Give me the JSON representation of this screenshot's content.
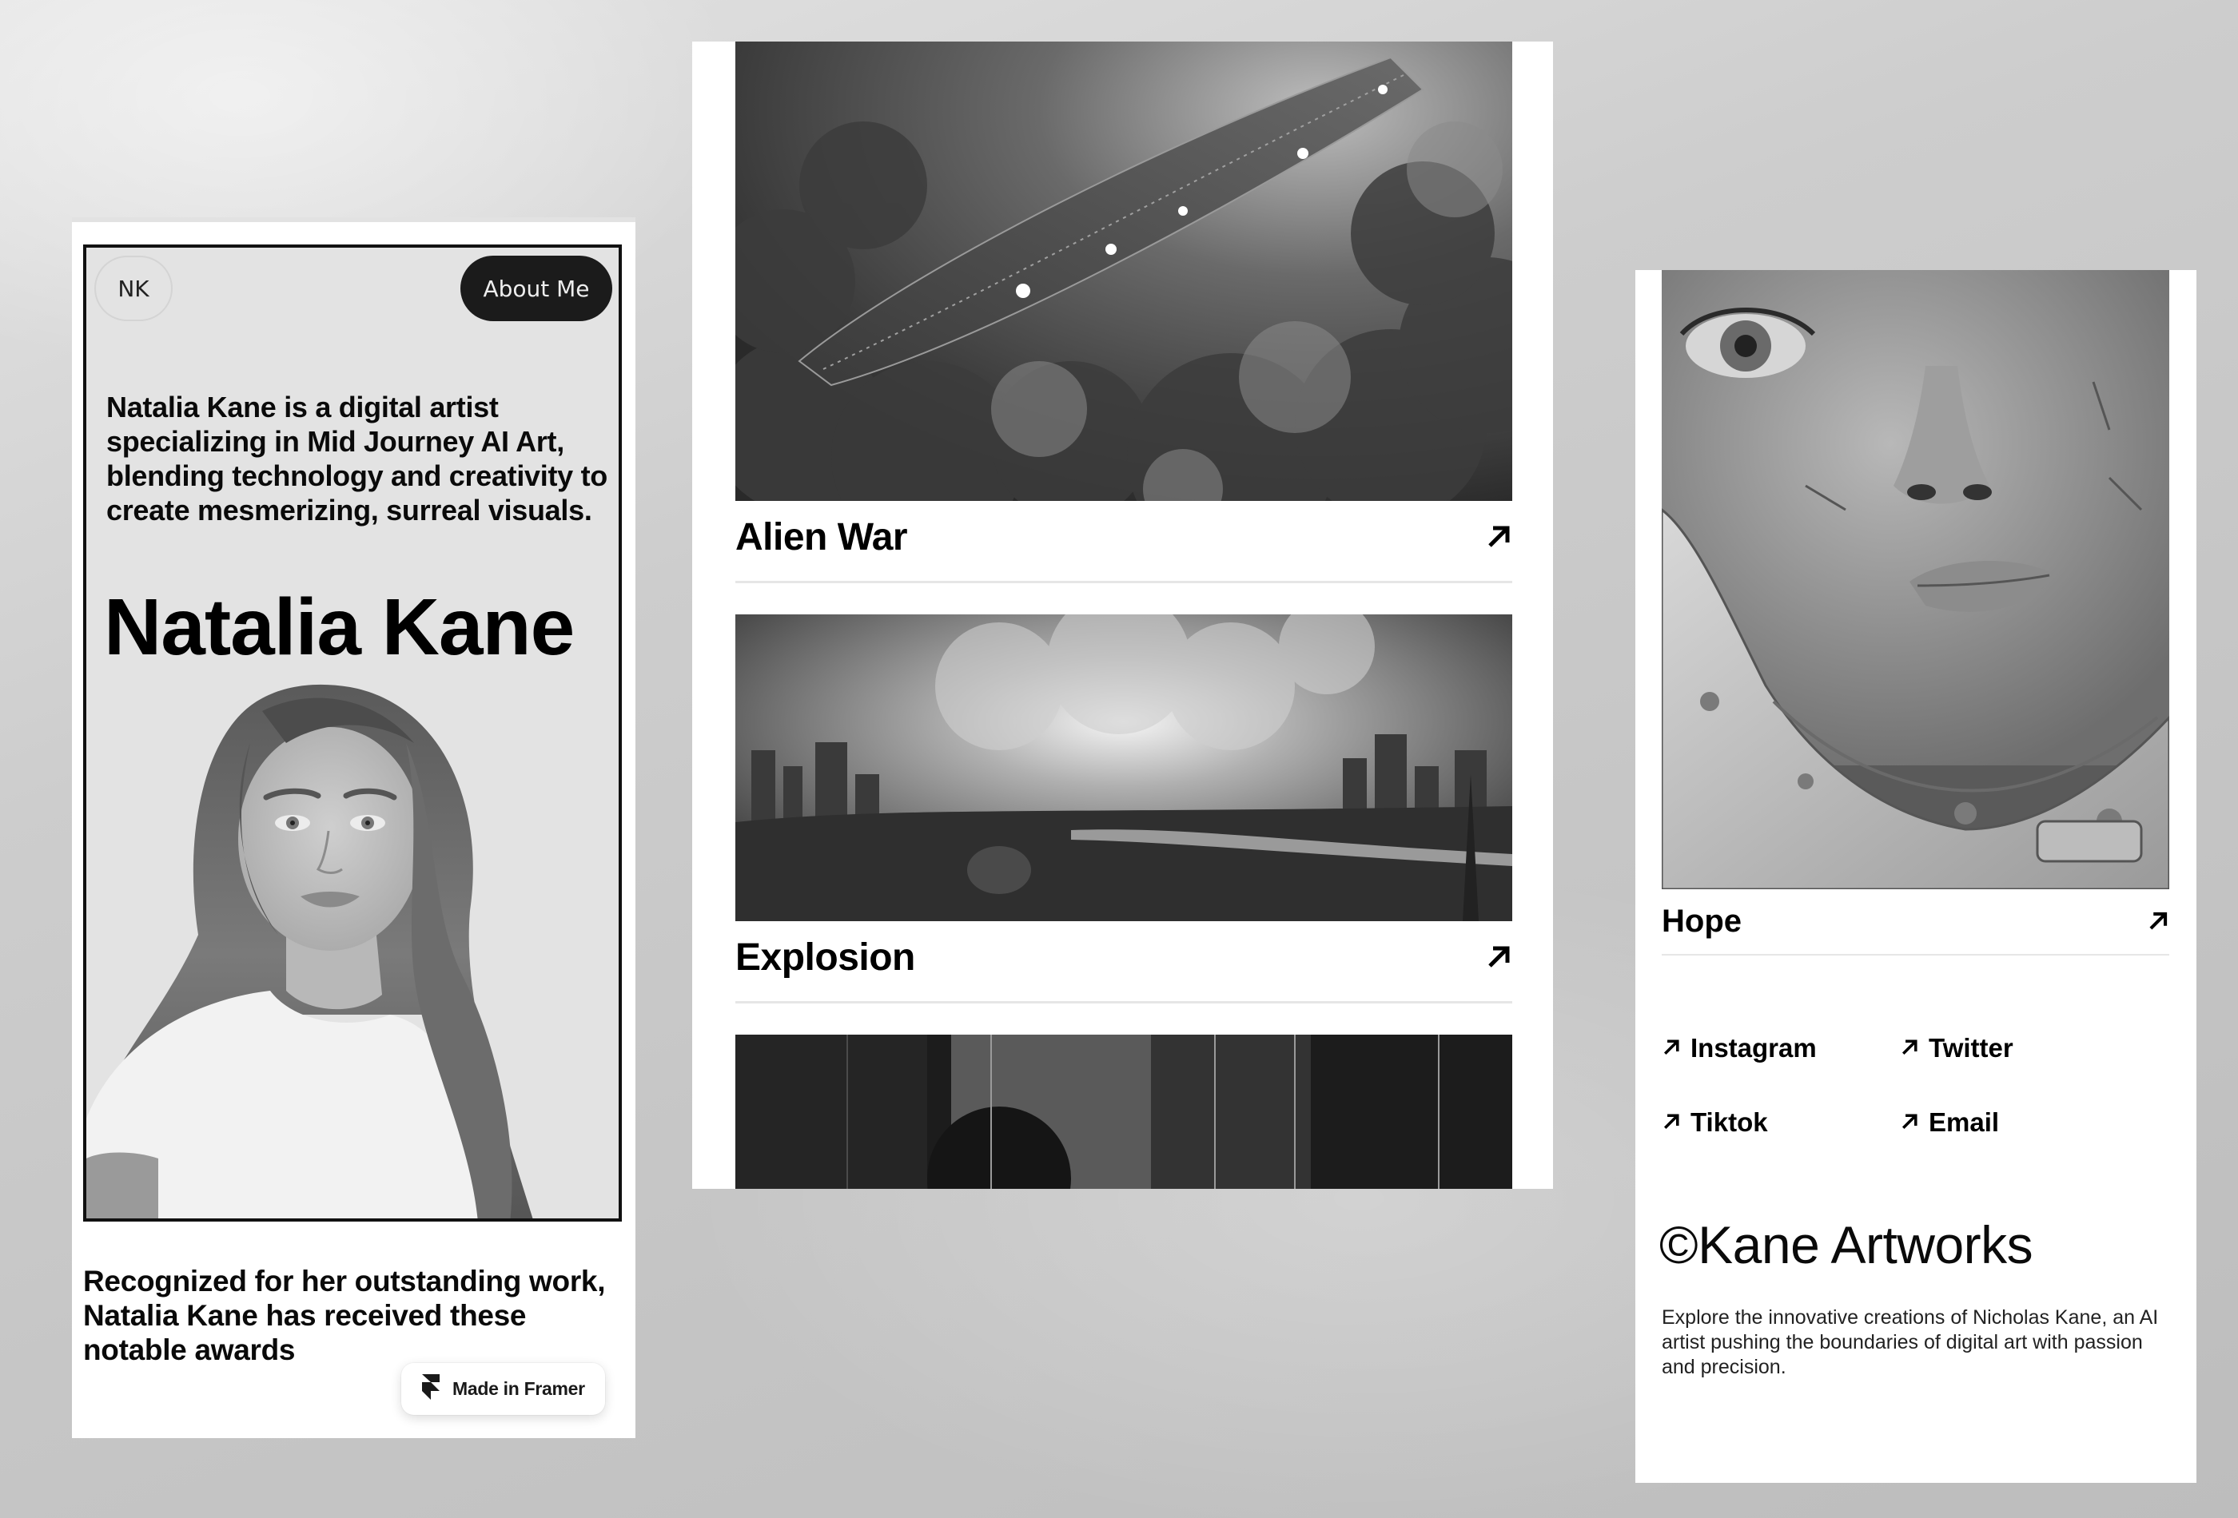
{
  "left_panel": {
    "nav": {
      "logo_initials": "NK",
      "about_button": "About Me"
    },
    "bio": "Natalia Kane is a digital artist specializing in Mid Journey AI Art, blending technology and creativity to create mesmerizing, surreal visuals.",
    "hero_title": "Natalia Kane",
    "portrait_alt": "Black and white portrait of a smiling woman with long wavy hair in a white t-shirt",
    "awards_intro": "Recognized for her outstanding work, Natalia Kane has received these notable awards",
    "framer_badge": {
      "icon": "framer-logo-icon",
      "label": "Made in Framer"
    }
  },
  "middle_panel": {
    "works": [
      {
        "title": "Alien War",
        "image": "Giant alien spaceship gliding over dark clouds",
        "icon": "arrow-up-right-icon"
      },
      {
        "title": "Explosion",
        "image": "Massive explosion over a city skyline with a river",
        "icon": "arrow-up-right-icon"
      },
      {
        "title": "",
        "image": "Dark abstract streaked painting (partially visible)"
      }
    ]
  },
  "right_panel": {
    "work": {
      "title": "Hope",
      "image": "Close-up of a woman's face in a worn cybernetic helmet",
      "icon": "arrow-up-right-icon"
    },
    "socials": [
      {
        "label": "Instagram",
        "icon": "arrow-up-right-icon"
      },
      {
        "label": "Twitter",
        "icon": "arrow-up-right-icon"
      },
      {
        "label": "Tiktok",
        "icon": "arrow-up-right-icon"
      },
      {
        "label": "Email",
        "icon": "arrow-up-right-icon"
      }
    ],
    "brand": "©Kane Artworks",
    "footer_text": "Explore the innovative creations of Nicholas Kane, an AI artist pushing the boundaries of digital art with passion and precision."
  },
  "colors": {
    "panel_bg": "#ffffff",
    "hero_bg": "#e3e3e3",
    "button_dark": "#1b1b1b",
    "divider": "#e6e6e6",
    "text": "#000000"
  }
}
